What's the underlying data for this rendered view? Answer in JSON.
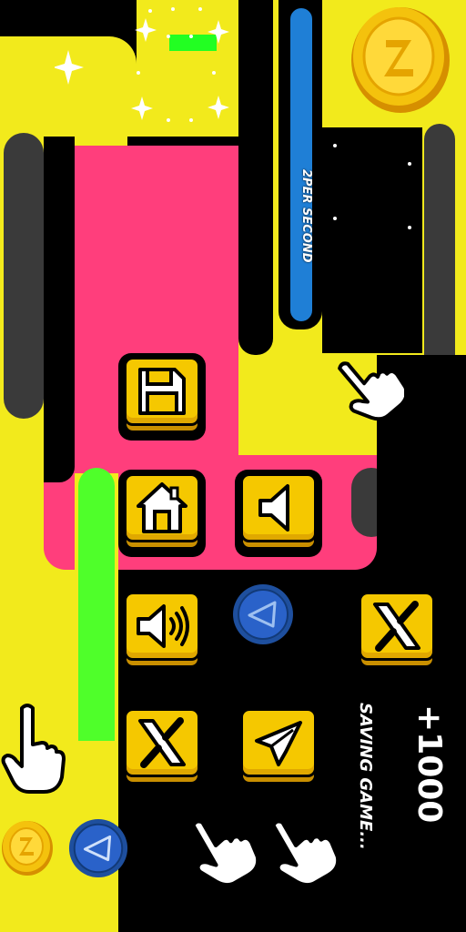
{
  "hud": {
    "per_second_label": "2PER SECOND",
    "bonus_text": "+1000",
    "saving_text": "SAVING GAME..."
  },
  "buttons": [
    {
      "name": "save-button",
      "icon": "floppy-disk-icon"
    },
    {
      "name": "home-button",
      "icon": "house-icon"
    },
    {
      "name": "mute-button",
      "icon": "speaker-muted-icon"
    },
    {
      "name": "sound-on-button",
      "icon": "speaker-on-icon"
    },
    {
      "name": "x-social-button",
      "icon": "x-logo-icon"
    },
    {
      "name": "x-social-button-2",
      "icon": "x-logo-icon"
    },
    {
      "name": "telegram-button",
      "icon": "telegram-icon"
    }
  ],
  "colors": {
    "yellow": "#f2ea1c",
    "pink": "#ff3e7c",
    "button_yellow": "#f5c800",
    "blue_bar": "#1f7fd6",
    "coin_gold": "#f4c20d",
    "telegram_blue": "#2a62c9"
  }
}
